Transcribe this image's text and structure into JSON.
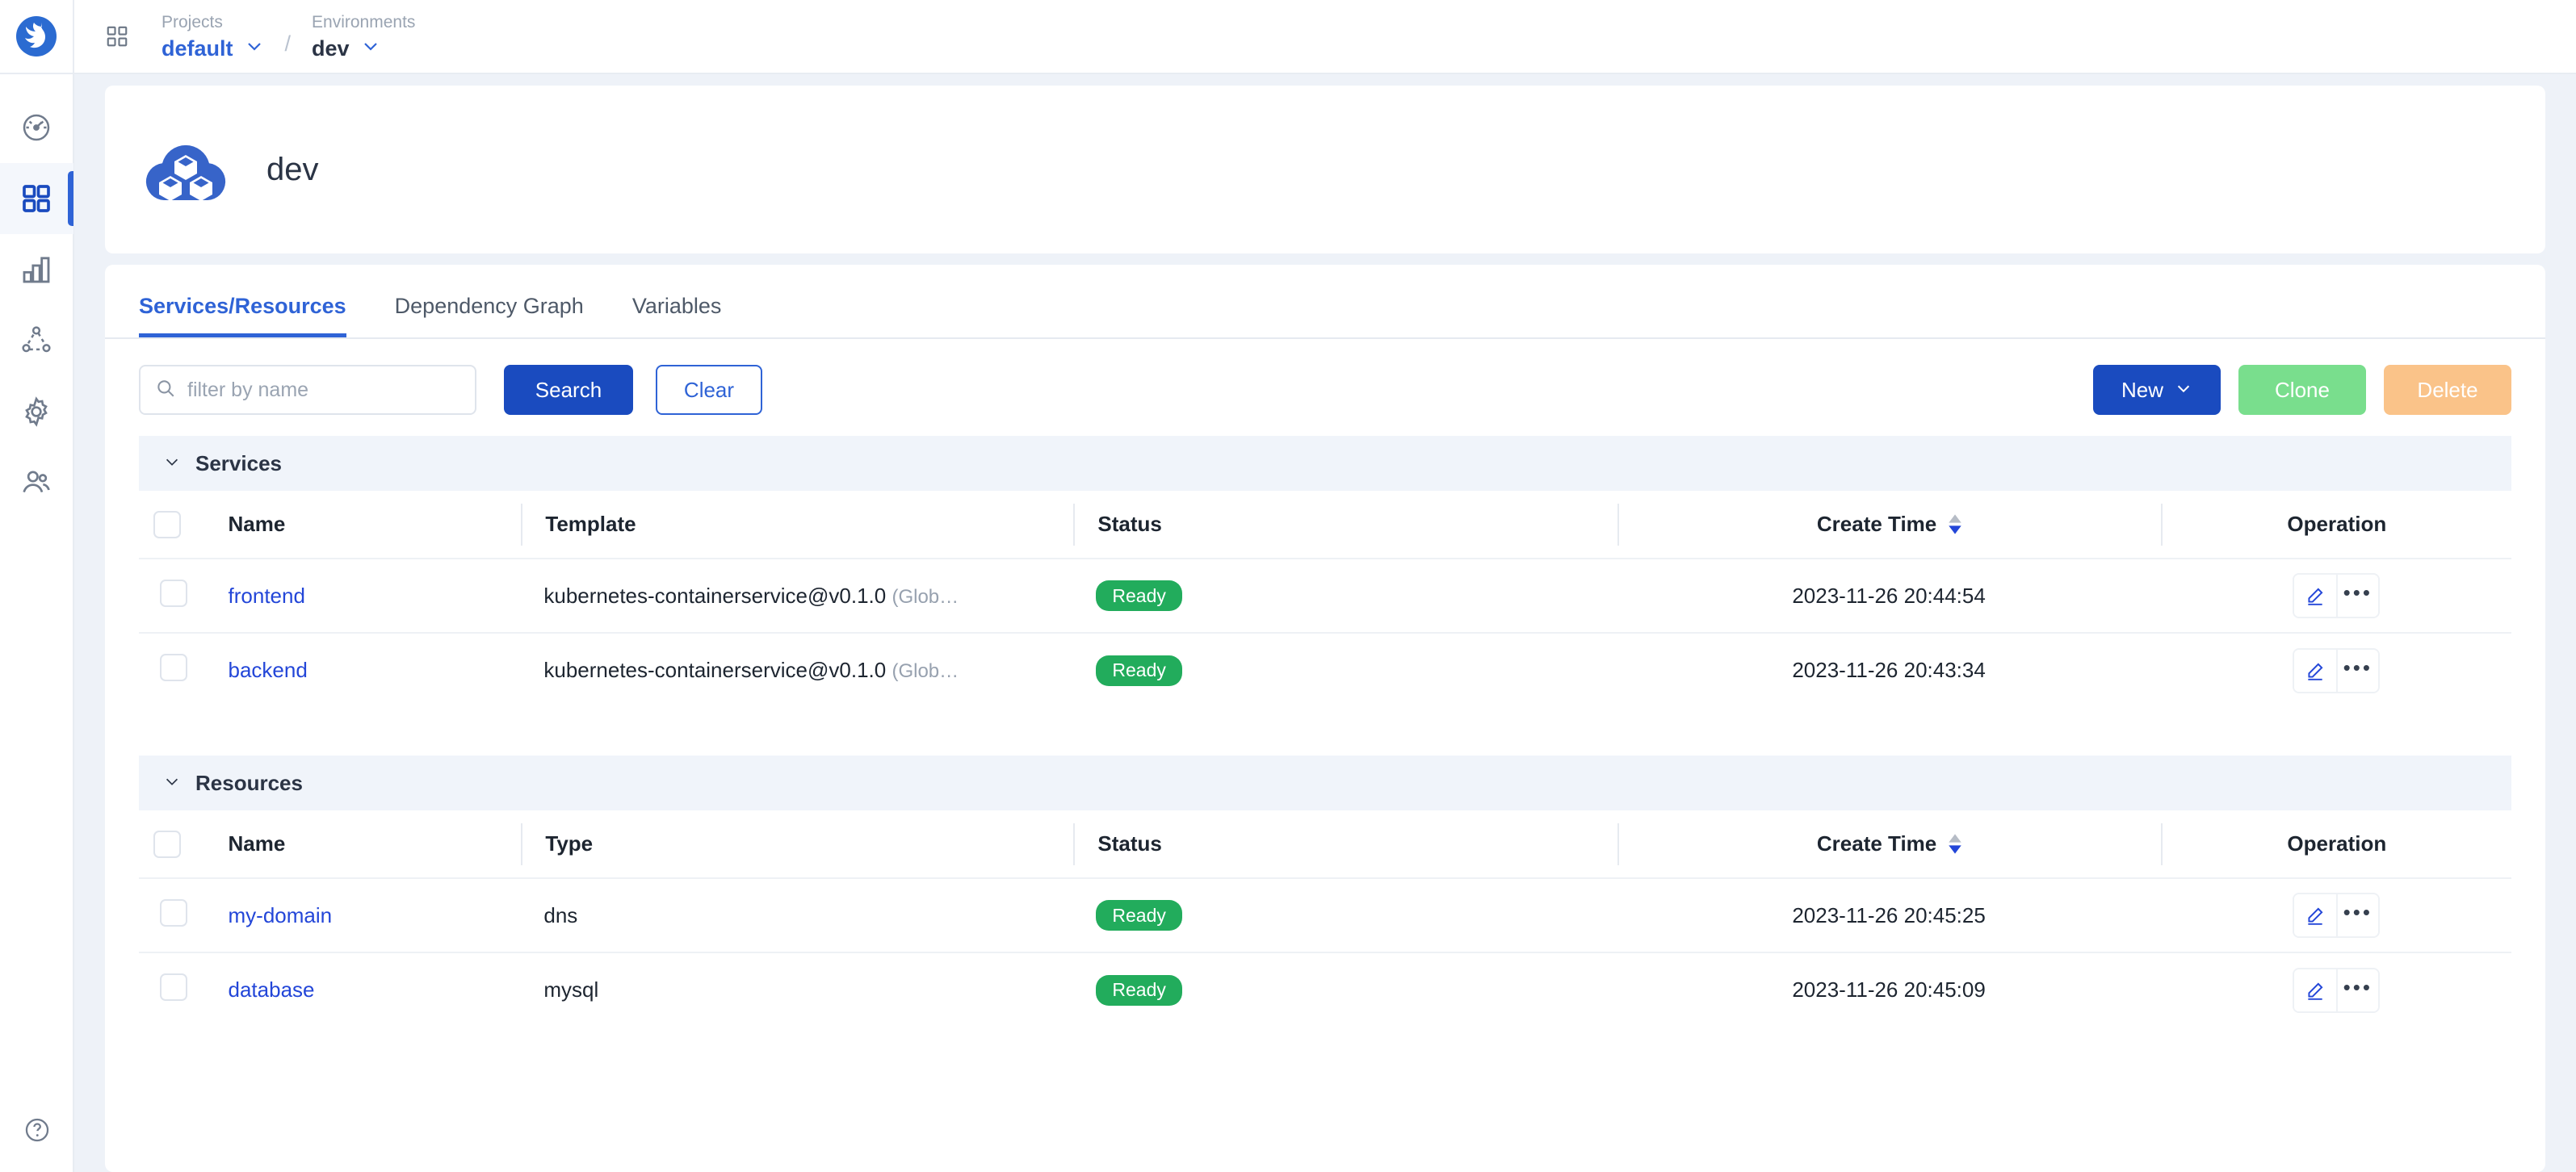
{
  "topbar": {
    "grid_icon": "grid-apps-icon",
    "projects": {
      "label": "Projects",
      "value": "default"
    },
    "separator": "/",
    "environments": {
      "label": "Environments",
      "value": "dev"
    }
  },
  "sidebar": {
    "brand_icon": "brand-logo-icon",
    "items": [
      {
        "name": "dashboard",
        "icon": "gauge-icon",
        "active": false
      },
      {
        "name": "applications",
        "icon": "grid-squares-icon",
        "active": true
      },
      {
        "name": "insights",
        "icon": "bar-chart-icon",
        "active": false
      },
      {
        "name": "topology",
        "icon": "network-nodes-icon",
        "active": false
      },
      {
        "name": "settings",
        "icon": "gear-icon",
        "active": false
      },
      {
        "name": "members",
        "icon": "users-icon",
        "active": false
      }
    ],
    "help": {
      "icon": "question-circle-icon"
    }
  },
  "env_header": {
    "icon": "cloud-cubes-icon",
    "title": "dev"
  },
  "tabs": [
    {
      "label": "Services/Resources",
      "active": true
    },
    {
      "label": "Dependency Graph",
      "active": false
    },
    {
      "label": "Variables",
      "active": false
    }
  ],
  "toolbar": {
    "search_placeholder": "filter by name",
    "search_value": "",
    "search_icon": "search-icon",
    "search_label": "Search",
    "clear_label": "Clear",
    "new_label": "New",
    "new_caret_icon": "chevron-down-icon",
    "clone_label": "Clone",
    "delete_label": "Delete"
  },
  "colors": {
    "accent_blue": "#2f63d6",
    "primary_button": "#1a4bbf",
    "link": "#2346d8",
    "status_ready": "#22ac5c",
    "clone_button": "#79de8d",
    "delete_button": "#fac389",
    "page_bg": "#eef2f8",
    "section_bar": "#f0f4fa"
  },
  "services": {
    "section_label": "Services",
    "collapse_icon": "chevron-down-icon",
    "columns": [
      "Name",
      "Template",
      "Status",
      "Create Time",
      "Operation"
    ],
    "sort_column": "Create Time",
    "sort_direction": "desc",
    "rows": [
      {
        "name": "frontend",
        "template_main": "kubernetes-containerservice@v0.1.0",
        "template_sub": "(Glob…",
        "status": "Ready",
        "create_time": "2023-11-26 20:44:54"
      },
      {
        "name": "backend",
        "template_main": "kubernetes-containerservice@v0.1.0",
        "template_sub": "(Glob…",
        "status": "Ready",
        "create_time": "2023-11-26 20:43:34"
      }
    ]
  },
  "resources": {
    "section_label": "Resources",
    "collapse_icon": "chevron-down-icon",
    "columns": [
      "Name",
      "Type",
      "Status",
      "Create Time",
      "Operation"
    ],
    "sort_column": "Create Time",
    "sort_direction": "desc",
    "rows": [
      {
        "name": "my-domain",
        "type": "dns",
        "status": "Ready",
        "create_time": "2023-11-26 20:45:25"
      },
      {
        "name": "database",
        "type": "mysql",
        "status": "Ready",
        "create_time": "2023-11-26 20:45:09"
      }
    ]
  }
}
